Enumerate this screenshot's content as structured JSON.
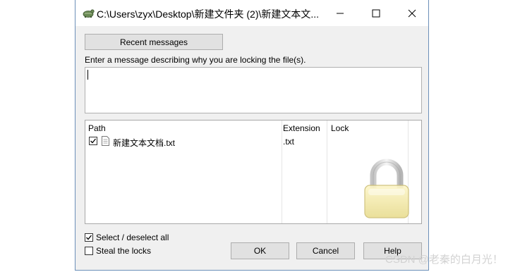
{
  "window": {
    "title": "C:\\Users\\zyx\\Desktop\\新建文件夹 (2)\\新建文本文..."
  },
  "dialog": {
    "recent_button": "Recent messages",
    "prompt": "Enter a message describing why you are locking the file(s).",
    "message_value": "",
    "columns": {
      "path": "Path",
      "extension": "Extension",
      "lock": "Lock"
    },
    "files": [
      {
        "checked": true,
        "icon": "text-file-icon",
        "path": "新建文本文档.txt",
        "extension": ".txt",
        "lock": ""
      }
    ],
    "select_all": {
      "label": "Select / deselect all",
      "checked": true
    },
    "steal_locks": {
      "label": "Steal the locks",
      "checked": false
    },
    "ok": "OK",
    "cancel": "Cancel",
    "help": "Help"
  },
  "watermark": "CSDN @老秦的白月光！",
  "icons": [
    "tortoise-svn-icon",
    "minimize-icon",
    "maximize-icon",
    "close-icon",
    "checkmark-icon",
    "text-file-icon",
    "padlock-icon"
  ]
}
